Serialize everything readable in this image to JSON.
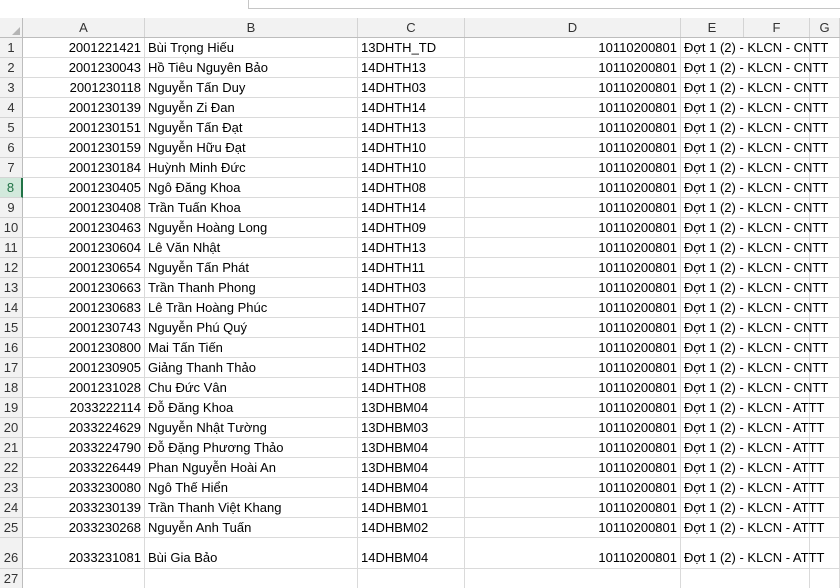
{
  "columns": [
    "A",
    "B",
    "C",
    "D",
    "E",
    "F",
    "G"
  ],
  "rows": [
    {
      "n": "1",
      "id": "2001221421",
      "name": "Bùi Trọng Hiếu",
      "cls": "13DHTH_TD",
      "code": "10110200801",
      "note": "Đợt 1 (2) - KLCN - CNTT"
    },
    {
      "n": "2",
      "id": "2001230043",
      "name": "Hồ Tiêu Nguyên Bảo",
      "cls": "14DHTH13",
      "code": "10110200801",
      "note": "Đợt 1 (2) - KLCN - CNTT"
    },
    {
      "n": "3",
      "id": "2001230118",
      "name": "Nguyễn Tấn Duy",
      "cls": "14DHTH03",
      "code": "10110200801",
      "note": "Đợt 1 (2) - KLCN - CNTT"
    },
    {
      "n": "4",
      "id": "2001230139",
      "name": "Nguyễn Zi Đan",
      "cls": "14DHTH14",
      "code": "10110200801",
      "note": "Đợt 1 (2) - KLCN - CNTT"
    },
    {
      "n": "5",
      "id": "2001230151",
      "name": "Nguyễn Tấn Đạt",
      "cls": "14DHTH13",
      "code": "10110200801",
      "note": "Đợt 1 (2) - KLCN - CNTT"
    },
    {
      "n": "6",
      "id": "2001230159",
      "name": "Nguyễn Hữu Đạt",
      "cls": "14DHTH10",
      "code": "10110200801",
      "note": "Đợt 1 (2) - KLCN - CNTT"
    },
    {
      "n": "7",
      "id": "2001230184",
      "name": "Huỳnh Minh Đức",
      "cls": "14DHTH10",
      "code": "10110200801",
      "note": "Đợt 1 (2) - KLCN - CNTT"
    },
    {
      "n": "8",
      "id": "2001230405",
      "name": "Ngô Đăng Khoa",
      "cls": "14DHTH08",
      "code": "10110200801",
      "note": "Đợt 1 (2) - KLCN - CNTT"
    },
    {
      "n": "9",
      "id": "2001230408",
      "name": "Trần Tuấn Khoa",
      "cls": "14DHTH14",
      "code": "10110200801",
      "note": "Đợt 1 (2) - KLCN - CNTT"
    },
    {
      "n": "10",
      "id": "2001230463",
      "name": "Nguyễn Hoàng Long",
      "cls": "14DHTH09",
      "code": "10110200801",
      "note": "Đợt 1 (2) - KLCN - CNTT"
    },
    {
      "n": "11",
      "id": "2001230604",
      "name": "Lê Văn Nhật",
      "cls": "14DHTH13",
      "code": "10110200801",
      "note": "Đợt 1 (2) - KLCN - CNTT"
    },
    {
      "n": "12",
      "id": "2001230654",
      "name": "Nguyễn Tấn Phát",
      "cls": "14DHTH11",
      "code": "10110200801",
      "note": "Đợt 1 (2) - KLCN - CNTT"
    },
    {
      "n": "13",
      "id": "2001230663",
      "name": "Trần Thanh Phong",
      "cls": "14DHTH03",
      "code": "10110200801",
      "note": "Đợt 1 (2) - KLCN - CNTT"
    },
    {
      "n": "14",
      "id": "2001230683",
      "name": "Lê Trần Hoàng Phúc",
      "cls": "14DHTH07",
      "code": "10110200801",
      "note": "Đợt 1 (2) - KLCN - CNTT"
    },
    {
      "n": "15",
      "id": "2001230743",
      "name": "Nguyễn Phú Quý",
      "cls": "14DHTH01",
      "code": "10110200801",
      "note": "Đợt 1 (2) - KLCN - CNTT"
    },
    {
      "n": "16",
      "id": "2001230800",
      "name": "Mai Tấn Tiến",
      "cls": "14DHTH02",
      "code": "10110200801",
      "note": "Đợt 1 (2) - KLCN - CNTT"
    },
    {
      "n": "17",
      "id": "2001230905",
      "name": "Giảng Thanh Thảo",
      "cls": "14DHTH03",
      "code": "10110200801",
      "note": "Đợt 1 (2) - KLCN - CNTT"
    },
    {
      "n": "18",
      "id": "2001231028",
      "name": "Chu Đức Vân",
      "cls": "14DHTH08",
      "code": "10110200801",
      "note": "Đợt 1 (2) - KLCN - CNTT"
    },
    {
      "n": "19",
      "id": "2033222114",
      "name": "Đỗ Đăng Khoa",
      "cls": "13DHBM04",
      "code": "10110200801",
      "note": "Đợt 1 (2) - KLCN - ATTT"
    },
    {
      "n": "20",
      "id": "2033224629",
      "name": "Nguyễn Nhật Tường",
      "cls": "13DHBM03",
      "code": "10110200801",
      "note": "Đợt 1 (2) - KLCN - ATTT"
    },
    {
      "n": "21",
      "id": "2033224790",
      "name": "Đỗ Đặng Phương Thảo",
      "cls": "13DHBM04",
      "code": "10110200801",
      "note": "Đợt 1 (2) - KLCN - ATTT"
    },
    {
      "n": "22",
      "id": "2033226449",
      "name": "Phan Nguyễn Hoài An",
      "cls": "13DHBM04",
      "code": "10110200801",
      "note": "Đợt 1 (2) - KLCN - ATTT"
    },
    {
      "n": "23",
      "id": "2033230080",
      "name": "Ngô Thế Hiển",
      "cls": "14DHBM04",
      "code": "10110200801",
      "note": "Đợt 1 (2) - KLCN - ATTT"
    },
    {
      "n": "24",
      "id": "2033230139",
      "name": "Trần Thanh Việt Khang",
      "cls": "14DHBM01",
      "code": "10110200801",
      "note": "Đợt 1 (2) - KLCN - ATTT"
    },
    {
      "n": "25",
      "id": "2033230268",
      "name": "Nguyễn Anh Tuấn",
      "cls": "14DHBM02",
      "code": "10110200801",
      "note": "Đợt 1 (2) - KLCN - ATTT"
    },
    {
      "n": "26",
      "id": "2033231081",
      "name": "Bùi Gia Bảo",
      "cls": "14DHBM04",
      "code": "10110200801",
      "note": "Đợt 1 (2) - KLCN - ATTT"
    },
    {
      "n": "27",
      "id": "",
      "name": "",
      "cls": "",
      "code": "",
      "note": ""
    }
  ],
  "active_row": "8",
  "colors": {
    "header_bg": "#f2f2f2",
    "active_row_bg": "#d2e9dc",
    "active_accent": "#217346",
    "grid": "#dadada"
  }
}
